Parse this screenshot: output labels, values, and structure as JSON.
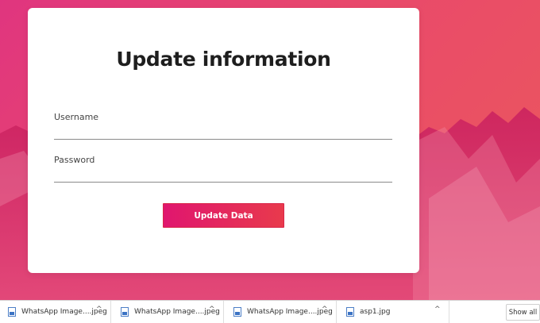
{
  "form": {
    "title": "Update information",
    "username_label": "Username",
    "username_value": "",
    "password_label": "Password",
    "password_value": "",
    "submit_label": "Update Data"
  },
  "downloads": {
    "items": [
      {
        "name": "WhatsApp Image....jpeg",
        "icon": "image-file-icon"
      },
      {
        "name": "WhatsApp Image....jpeg",
        "icon": "image-file-icon"
      },
      {
        "name": "WhatsApp Image....jpeg",
        "icon": "image-file-icon"
      },
      {
        "name": "asp1.jpg",
        "icon": "image-file-icon"
      }
    ],
    "chevron": "^",
    "show_all_label": "Show all"
  },
  "colors": {
    "gradient_start": "#e0357f",
    "gradient_end": "#ec5a5a",
    "button_start": "#e0166f",
    "button_end": "#e83a4c"
  }
}
